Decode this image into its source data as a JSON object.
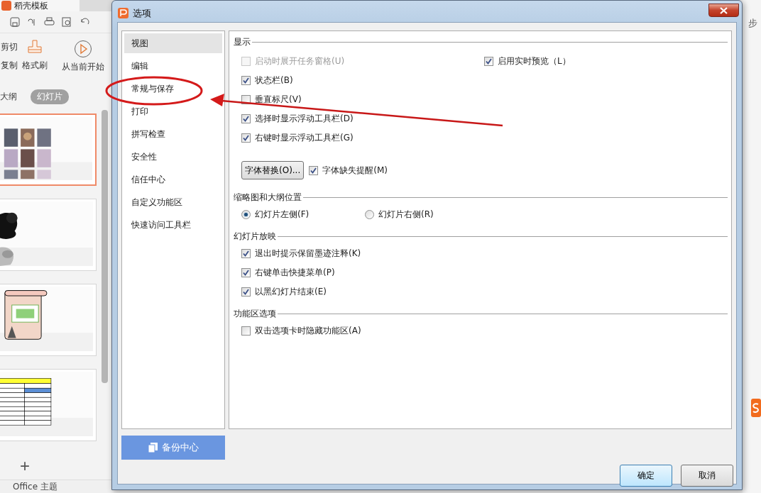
{
  "app": {
    "tab_label": "稻壳模板",
    "ribbon": [
      {
        "kind": "text",
        "label": "剪切"
      },
      {
        "kind": "text",
        "label": "复制"
      },
      {
        "kind": "brush",
        "label": "格式刷"
      },
      {
        "kind": "play",
        "label": "从当前开始"
      }
    ],
    "view_tabs": [
      {
        "label": "大纲",
        "selected": false
      },
      {
        "label": "幻灯片",
        "selected": true
      }
    ],
    "slides": [
      {
        "kind": "photo-grid",
        "selected": true
      },
      {
        "kind": "ink",
        "selected": false
      },
      {
        "kind": "scroll",
        "selected": false
      },
      {
        "kind": "table",
        "selected": false
      }
    ],
    "add_slide": "+",
    "status_bar": [
      "Office 主题"
    ],
    "right_edge_text": "步"
  },
  "dialog": {
    "title": "选项",
    "sidebar": [
      {
        "label": "视图",
        "selected": true
      },
      {
        "label": "编辑",
        "selected": false
      },
      {
        "label": "常规与保存",
        "selected": false
      },
      {
        "label": "打印",
        "selected": false
      },
      {
        "label": "拼写检查",
        "selected": false
      },
      {
        "label": "安全性",
        "selected": false
      },
      {
        "label": "信任中心",
        "selected": false
      },
      {
        "label": "自定义功能区",
        "selected": false
      },
      {
        "label": "快速访问工具栏",
        "selected": false
      }
    ],
    "sections": [
      {
        "title": "显示",
        "rows": [
          {
            "kind": "wide",
            "items": [
              {
                "kind": "checkbox",
                "label": "启动时展开任务窗格(U)",
                "checked": false,
                "disabled": true
              },
              {
                "kind": "checkbox",
                "label": "启用实时预览（L）",
                "checked": true,
                "disabled": false
              }
            ]
          },
          {
            "kind": "single",
            "items": [
              {
                "kind": "checkbox",
                "label": "状态栏(B)",
                "checked": true,
                "disabled": false
              }
            ]
          },
          {
            "kind": "single",
            "items": [
              {
                "kind": "checkbox",
                "label": "垂直标尺(V)",
                "checked": false,
                "disabled": false
              }
            ]
          },
          {
            "kind": "single",
            "items": [
              {
                "kind": "checkbox",
                "label": "选择时显示浮动工具栏(D)",
                "checked": true,
                "disabled": false
              }
            ]
          },
          {
            "kind": "single",
            "items": [
              {
                "kind": "checkbox",
                "label": "右键时显示浮动工具栏(G)",
                "checked": true,
                "disabled": false
              }
            ]
          },
          {
            "kind": "inline",
            "items": [
              {
                "kind": "button",
                "label": "字体替换(O)..."
              },
              {
                "kind": "checkbox",
                "label": "字体缺失提醒(M)",
                "checked": true,
                "disabled": false
              }
            ]
          }
        ]
      },
      {
        "title": "缩略图和大纲位置",
        "rows": [
          {
            "kind": "pair",
            "items": [
              {
                "kind": "radio",
                "label": "幻灯片左侧(F)",
                "selected": true
              },
              {
                "kind": "radio",
                "label": "幻灯片右侧(R)",
                "selected": false
              }
            ]
          }
        ]
      },
      {
        "title": "幻灯片放映",
        "rows": [
          {
            "kind": "single",
            "items": [
              {
                "kind": "checkbox",
                "label": "退出时提示保留墨迹注释(K)",
                "checked": true,
                "disabled": false
              }
            ]
          },
          {
            "kind": "single",
            "items": [
              {
                "kind": "checkbox",
                "label": "右键单击快捷菜单(P)",
                "checked": true,
                "disabled": false
              }
            ]
          },
          {
            "kind": "single",
            "items": [
              {
                "kind": "checkbox",
                "label": "以黑幻灯片结束(E)",
                "checked": true,
                "disabled": false
              }
            ]
          }
        ]
      },
      {
        "title": "功能区选项",
        "rows": [
          {
            "kind": "single",
            "items": [
              {
                "kind": "checkbox",
                "label": "双击选项卡时隐藏功能区(A)",
                "checked": false,
                "disabled": false
              }
            ]
          }
        ]
      }
    ],
    "backup_button": "备份中心",
    "buttons": [
      {
        "label": "确定",
        "default": true
      },
      {
        "label": "取消",
        "default": false
      }
    ]
  }
}
